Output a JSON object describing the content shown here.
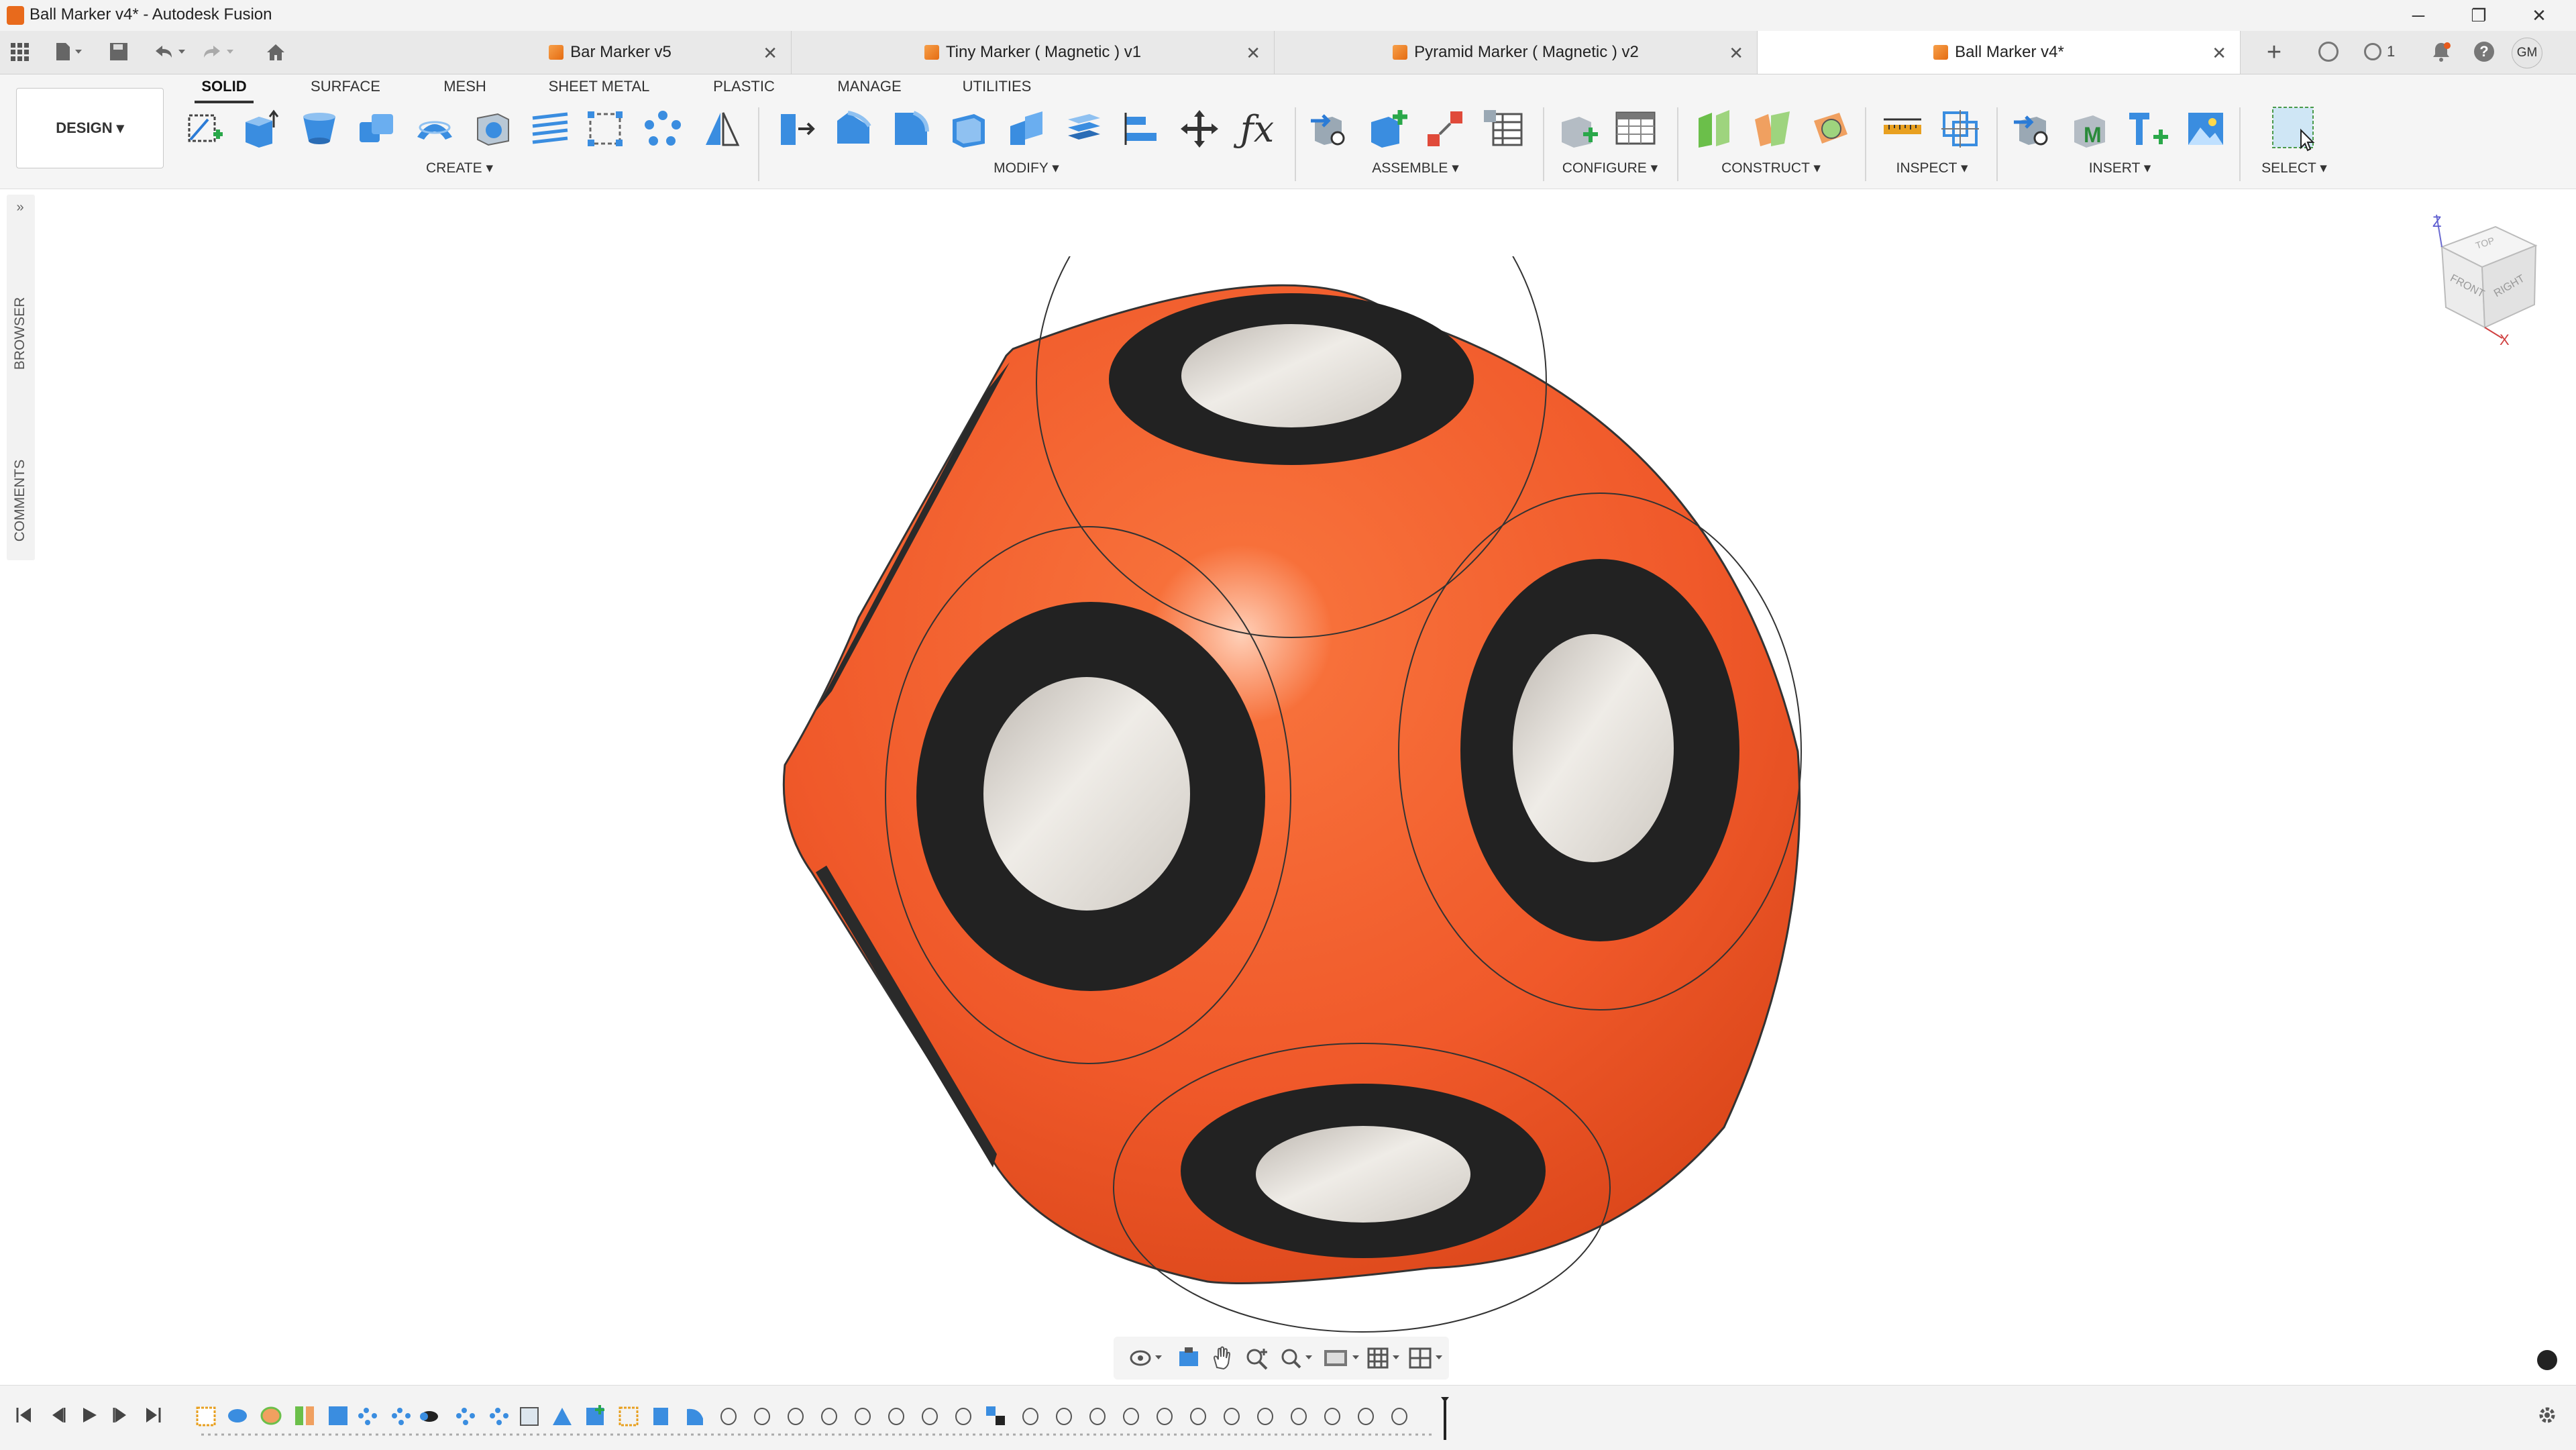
{
  "window": {
    "title": "Ball Marker v4* - Autodesk Fusion",
    "controls": {
      "minimize": "─",
      "restore": "❐",
      "close": "✕"
    }
  },
  "doc_tabs": [
    {
      "label": "Bar Marker v5",
      "active": false
    },
    {
      "label": "Tiny Marker ( Magnetic ) v1",
      "active": false
    },
    {
      "label": "Pyramid Marker ( Magnetic ) v2",
      "active": false
    },
    {
      "label": "Ball Marker v4*",
      "active": true
    }
  ],
  "tabbar_right": {
    "job_count": "1",
    "user_initials": "GM"
  },
  "workspace": {
    "label": "DESIGN ▾"
  },
  "ribbon_tabs": [
    "SOLID",
    "SURFACE",
    "MESH",
    "SHEET METAL",
    "PLASTIC",
    "MANAGE",
    "UTILITIES"
  ],
  "ribbon_groups": [
    "CREATE ▾",
    "MODIFY ▾",
    "ASSEMBLE ▾",
    "CONFIGURE ▾",
    "CONSTRUCT ▾",
    "INSPECT ▾",
    "INSERT ▾",
    "SELECT ▾"
  ],
  "side_tabs": [
    "BROWSER",
    "COMMENTS"
  ],
  "view_cube": {
    "top": "TOP",
    "front": "FRONT",
    "right": "RIGHT",
    "z_axis": "Z",
    "x_axis": "X"
  },
  "colors": {
    "body": "#f0592a",
    "ring": "#222222",
    "magnet": "#d6d2cc",
    "accent": "#2b7bd6"
  }
}
